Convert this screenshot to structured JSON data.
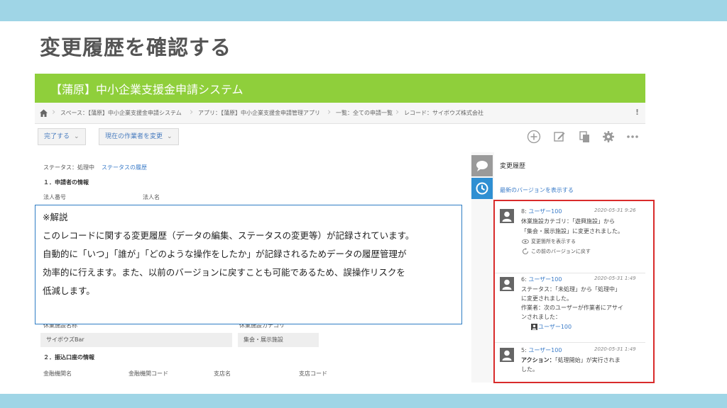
{
  "slide": {
    "title": "変更履歴を確認する",
    "colors": {
      "band": "#9fd5e6",
      "header_green": "#8fcf3b",
      "highlight_red": "#d92b2b",
      "note_border": "#2e7dc4",
      "link": "#3a7bc8"
    }
  },
  "app": {
    "title": "【蒲原】中小企業支援金申請システム",
    "breadcrumb": {
      "items": [
        "スペース：【蒲原】中小企業支援金申請システム",
        "アプリ：【蒲原】中小企業支援金申請管理アプリ",
        "一覧：全ての申請一覧",
        "レコード：サイボウズ株式会社"
      ],
      "end_mark": "!"
    },
    "actions": {
      "complete_label": "完了する",
      "assignee_label": "現在の作業者を変更",
      "icons": [
        "add-icon",
        "edit-icon",
        "copy-icon",
        "gear-icon",
        "more-icon"
      ]
    }
  },
  "form": {
    "status_label": "ステータス：処理中",
    "status_link": "ステータスの履歴",
    "section1": "１．申請者の情報",
    "corp_number_label": "法人番号",
    "corp_name_label": "法人名",
    "facility_name_label": "休業施設名称",
    "facility_name_value": "サイボウズBar",
    "facility_category_label": "休業施設カテゴリ",
    "facility_category_value": "集会・展示施設",
    "section2": "２．振込口座の情報",
    "bank_name_label": "金融機関名",
    "bank_code_label": "金融機関コード",
    "branch_name_label": "支店名",
    "branch_code_label": "支店コード"
  },
  "history": {
    "title": "変更履歴",
    "latest_link": "最新のバージョンを表示する",
    "entries": [
      {
        "version": "8:",
        "user": "ユーザー100",
        "date": "2020-05-31 9:26",
        "lines": [
          "休業施設カテゴリ：「遊興施設」から",
          "「集会・展示施設」に変更されました。"
        ],
        "show_changes": "変更箇所を表示する",
        "revert": "この前のバージョンに戻す"
      },
      {
        "version": "6:",
        "user": "ユーザー100",
        "date": "2020-05-31 1:49",
        "lines": [
          "ステータス：「未処理」から「処理中」",
          "に変更されました。",
          "作業者：次のユーザーが作業者にアサイ",
          "ンされました："
        ],
        "assigned_user": "ユーザー100"
      },
      {
        "version": "5:",
        "user": "ユーザー100",
        "date": "2020-05-31 1:49",
        "action_label": "アクション：",
        "lines": [
          "「処理開始」が実行されま",
          "した。"
        ]
      }
    ]
  },
  "note": {
    "heading": "※解説",
    "lines": [
      "このレコードに関する変更履歴（データの編集、ステータスの変更等）が記録されています。",
      "自動的に「いつ」「誰が」「どのような操作をしたか」が記録されるためデータの履歴管理が",
      "効率的に行えます。また、以前のバージョンに戻すことも可能であるため、誤操作リスクを",
      "低減します。"
    ]
  }
}
